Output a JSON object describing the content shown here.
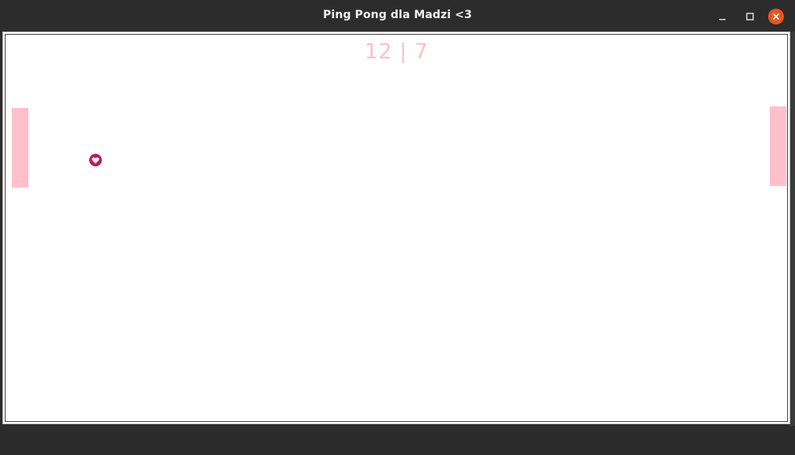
{
  "window": {
    "title": "Ping Pong dla Madzi <3"
  },
  "icons": {
    "minimize": "minimize-icon",
    "maximize": "maximize-icon",
    "close": "close-icon",
    "ball": "heart-icon"
  },
  "game": {
    "score_text": "12 | 7",
    "colors": {
      "background": "#ffffff",
      "paddle": "#ffc0cb",
      "score": "#ffc0cb",
      "ball": "#c2185b",
      "ball_heart": "#ffffff"
    }
  },
  "colors": {
    "titlebar": "#2c2c2c",
    "close_button": "#e95420"
  }
}
